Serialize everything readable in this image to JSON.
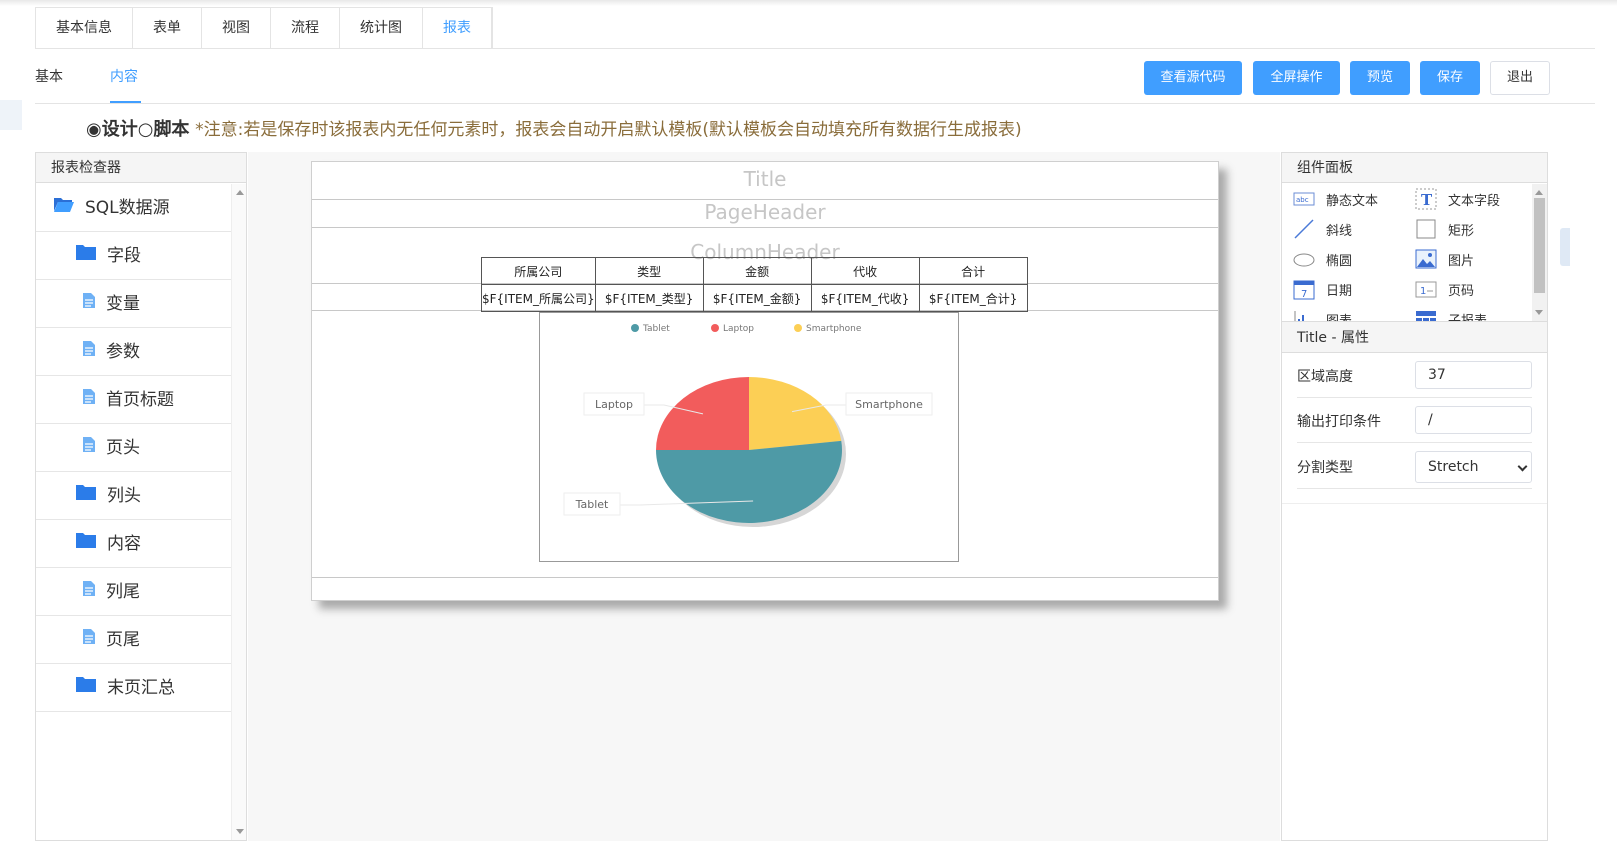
{
  "main_tabs": [
    {
      "label": "基本信息",
      "active": false
    },
    {
      "label": "表单",
      "active": false
    },
    {
      "label": "视图",
      "active": false
    },
    {
      "label": "流程",
      "active": false
    },
    {
      "label": "统计图",
      "active": false
    },
    {
      "label": "报表",
      "active": true
    }
  ],
  "sub_tabs": {
    "basic": "基本",
    "content": "内容"
  },
  "toolbar": {
    "view_source": "查看源代码",
    "fullscreen": "全屏操作",
    "preview": "预览",
    "save": "保存",
    "exit": "退出"
  },
  "mode": {
    "design": "设计",
    "script": "脚本",
    "selected": "design",
    "note": "*注意:若是保存时该报表内无任何元素时，报表会自动开启默认模板(默认模板会自动填充所有数据行生成报表)"
  },
  "inspector": {
    "title": "报表检查器",
    "items": [
      {
        "label": "SQL数据源",
        "icon": "folder-open-icon",
        "level": 0
      },
      {
        "label": "字段",
        "icon": "folder-icon",
        "level": 1
      },
      {
        "label": "变量",
        "icon": "file-icon",
        "level": 2
      },
      {
        "label": "参数",
        "icon": "file-icon",
        "level": 2
      },
      {
        "label": "首页标题",
        "icon": "file-icon",
        "level": 2
      },
      {
        "label": "页头",
        "icon": "file-icon",
        "level": 2
      },
      {
        "label": "列头",
        "icon": "folder-icon",
        "level": 1
      },
      {
        "label": "内容",
        "icon": "folder-icon",
        "level": 1
      },
      {
        "label": "列尾",
        "icon": "file-icon",
        "level": 2
      },
      {
        "label": "页尾",
        "icon": "file-icon",
        "level": 2
      },
      {
        "label": "末页汇总",
        "icon": "folder-icon",
        "level": 1
      }
    ]
  },
  "designer": {
    "bands": {
      "title": "Title",
      "page_header": "PageHeader",
      "column_header": "ColumnHeader"
    },
    "grid_headers": [
      "所属公司",
      "类型",
      "金额",
      "代收",
      "合计"
    ],
    "grid_fields": [
      "$F{ITEM_所属公司}",
      "$F{ITEM_类型}",
      "$F{ITEM_金额}",
      "$F{ITEM_代收}",
      "$F{ITEM_合计}"
    ]
  },
  "colors": {
    "accent": "#409eff",
    "tablet": "#4e9aa6",
    "laptop": "#f25c5c",
    "smartphone": "#fccf55"
  },
  "chart_data": {
    "type": "pie",
    "title": "",
    "categories": [
      "Tablet",
      "Laptop",
      "Smartphone"
    ],
    "values": [
      52,
      25,
      23
    ],
    "legend": "top"
  },
  "components": {
    "title": "组件面板",
    "items": [
      {
        "label": "静态文本",
        "icon": "static-text-icon"
      },
      {
        "label": "文本字段",
        "icon": "text-field-icon"
      },
      {
        "label": "斜线",
        "icon": "line-icon"
      },
      {
        "label": "矩形",
        "icon": "rectangle-icon"
      },
      {
        "label": "椭圆",
        "icon": "ellipse-icon"
      },
      {
        "label": "图片",
        "icon": "image-icon"
      },
      {
        "label": "日期",
        "icon": "calendar-icon"
      },
      {
        "label": "页码",
        "icon": "page-number-icon"
      },
      {
        "label": "图表",
        "icon": "chart-icon"
      },
      {
        "label": "子报表",
        "icon": "subreport-icon"
      }
    ]
  },
  "properties": {
    "title": "Title - 属性",
    "region_height_label": "区域高度",
    "region_height_value": "37",
    "print_condition_label": "输出打印条件",
    "print_condition_value": "/",
    "split_type_label": "分割类型",
    "split_type_value": "Stretch"
  }
}
